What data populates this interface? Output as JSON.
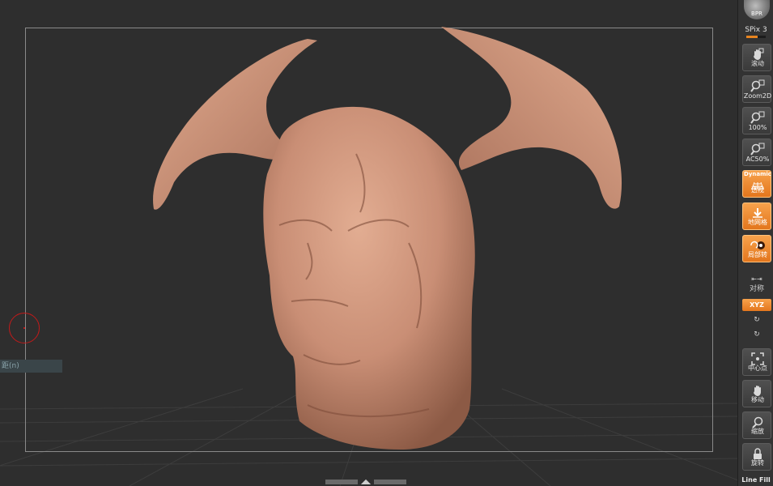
{
  "viewport": {
    "side_label": "距(n)"
  },
  "shelf": {
    "bpr": {
      "label": "BPR",
      "icon": "sphere-icon"
    },
    "spix": {
      "label": "SPix 3",
      "value": 3
    },
    "buttons": [
      {
        "id": "scroll",
        "label": "滚动",
        "icon": "hand-icon",
        "active": false
      },
      {
        "id": "zoom2d",
        "label": "Zoom2D",
        "icon": "magnifier-icon",
        "active": false
      },
      {
        "id": "zoom100",
        "label": "100%",
        "icon": "magnifier-icon",
        "active": false
      },
      {
        "id": "ac50",
        "label": "AC50%",
        "icon": "magnifier-icon",
        "active": false
      },
      {
        "id": "perspective",
        "label": "透视",
        "badge": "Dynamic",
        "icon": "perspective-grid-icon",
        "active": true
      },
      {
        "id": "floor",
        "label": "地网格",
        "icon": "floor-grid-icon",
        "active": true
      },
      {
        "id": "local",
        "label": "局部转",
        "icon": "local-rotate-icon",
        "active": true
      }
    ],
    "symmetry": {
      "label": "对称",
      "icon": "symmetry-arrows-icon"
    },
    "xyz": {
      "label": "XYZ",
      "active": true
    },
    "rotate_y": {
      "icon": "rotate-y-icon"
    },
    "rotate_z": {
      "icon": "rotate-z-icon"
    },
    "lower_buttons": [
      {
        "id": "center",
        "label": "中心点",
        "icon": "frame-center-icon"
      },
      {
        "id": "move",
        "label": "移动",
        "icon": "hand-icon"
      },
      {
        "id": "scale",
        "label": "缩放",
        "icon": "magnifier-icon"
      },
      {
        "id": "rotate",
        "label": "旋转",
        "icon": "rotate-lock-icon"
      }
    ],
    "line_fill": "Line Fill"
  },
  "colors": {
    "viewport_bg": "#2e2e2e",
    "shelf_bg": "#333333",
    "accent_orange": "#e7841f",
    "clay": "#c98e75",
    "brush_red": "#c21a1a"
  }
}
